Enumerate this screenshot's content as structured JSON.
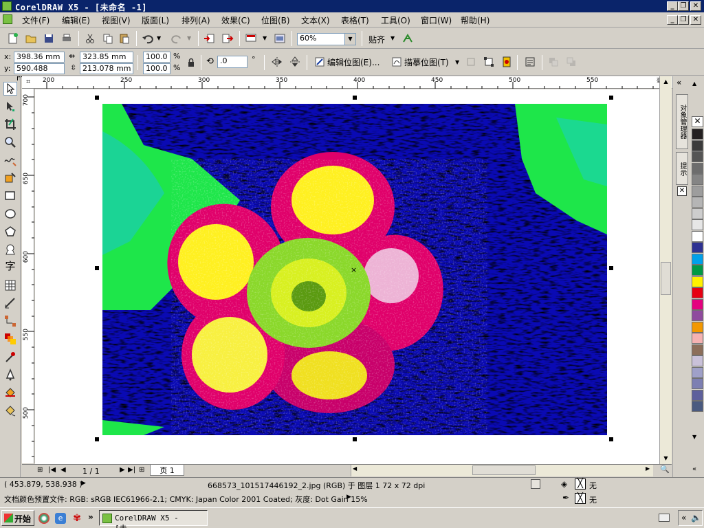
{
  "window": {
    "title": "CorelDRAW X5 - [未命名 -1]",
    "controls": [
      "_",
      "❐",
      "✕"
    ]
  },
  "menu": {
    "items": [
      "文件(F)",
      "编辑(E)",
      "视图(V)",
      "版面(L)",
      "排列(A)",
      "效果(C)",
      "位图(B)",
      "文本(X)",
      "表格(T)",
      "工具(O)",
      "窗口(W)",
      "帮助(H)"
    ]
  },
  "toolbar": {
    "zoom_value": "60%",
    "snap_label": "贴齐"
  },
  "property_bar": {
    "x_label": "x:",
    "y_label": "y:",
    "x_value": "398.36 mm",
    "y_value": "590.488 mm",
    "w_value": "323.85 mm",
    "h_value": "213.078 mm",
    "scale_x": "100.0",
    "scale_y": "100.0",
    "percent": "%",
    "rotate_value": ".0",
    "degree": "°",
    "edit_bitmap_label": "编辑位图(E)...",
    "trace_bitmap_label": "描摹位图(T)"
  },
  "rulers": {
    "unit": "毫米",
    "h_ticks": [
      "200",
      "250",
      "300",
      "350",
      "400",
      "450",
      "500",
      "550"
    ],
    "v_ticks": [
      "700",
      "650",
      "600",
      "550",
      "500"
    ]
  },
  "page_nav": {
    "counter": "1 / 1",
    "tab_label": "页 1"
  },
  "docker": {
    "tabs": [
      "对象管理器",
      "提示"
    ]
  },
  "palette": {
    "colors": [
      "#231f20",
      "#3b3b3b",
      "#555555",
      "#6d6d6d",
      "#858585",
      "#9d9d9d",
      "#b5b5b5",
      "#cdcdcd",
      "#e6e6e6",
      "#ffffff",
      "#2e3192",
      "#00a0e9",
      "#009944",
      "#fff100",
      "#e60012",
      "#e4007f",
      "#8f4a9e",
      "#f39800",
      "#f5b2b2",
      "#8c6e5a",
      "#c9c1d9",
      "#9fa0c8",
      "#7d7fb2",
      "#5e609c",
      "#4a5a80"
    ]
  },
  "status": {
    "coords": "( 453.879, 538.938 )",
    "object_info": "668573_101517446192_2.jpg (RGB) 于 图层 1 72 x 72 dpi",
    "color_profile": "文档颜色预置文件: RGB: sRGB IEC61966-2.1; CMYK: Japan Color 2001 Coated; 灰度: Dot Gain 15%",
    "fill_label": "无",
    "outline_label": "无"
  },
  "taskbar": {
    "start_label": "开始",
    "task_label": "CorelDRAW X5 - [未..."
  },
  "canvas_image": {
    "description_colors": {
      "background": "#0a0aa0",
      "leaves": "#22e84a",
      "petals": "#e0006a",
      "highlight": "#fff020",
      "outline": "#000000"
    }
  }
}
